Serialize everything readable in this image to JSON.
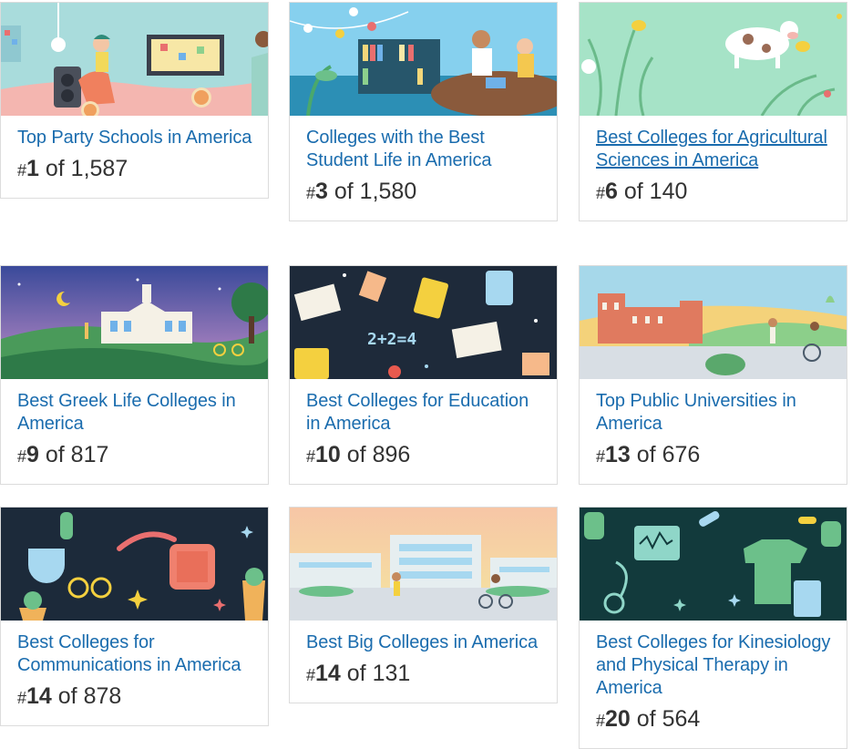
{
  "rankings": [
    {
      "title": "Top Party Schools in America",
      "hash": "#",
      "rank": "1",
      "of_text": "of 1,587",
      "scene": "party-scene"
    },
    {
      "title": "Colleges with the Best Student Life in America",
      "hash": "#",
      "rank": "3",
      "of_text": "of 1,580",
      "scene": "student-life-scene"
    },
    {
      "title": "Best Colleges for Agricultural Sciences in America",
      "hash": "#",
      "rank": "6",
      "of_text": "of 140",
      "scene": "agriculture-scene"
    },
    {
      "title": "Best Greek Life Colleges in America",
      "hash": "#",
      "rank": "9",
      "of_text": "of 817",
      "scene": "greek-life-scene"
    },
    {
      "title": "Best Colleges for Education in America",
      "hash": "#",
      "rank": "10",
      "of_text": "of 896",
      "scene": "education-scene"
    },
    {
      "title": "Top Public Universities in America",
      "hash": "#",
      "rank": "13",
      "of_text": "of 676",
      "scene": "public-university-scene"
    },
    {
      "title": "Best Colleges for Communications in America",
      "hash": "#",
      "rank": "14",
      "of_text": "of 878",
      "scene": "communications-scene"
    },
    {
      "title": "Best Big Colleges in America",
      "hash": "#",
      "rank": "14",
      "of_text": "of 131",
      "scene": "big-college-scene"
    },
    {
      "title": "Best Colleges for Kinesiology and Physical Therapy in America",
      "hash": "#",
      "rank": "20",
      "of_text": "of 564",
      "scene": "kinesiology-scene"
    }
  ],
  "colors": {
    "link": "#1a6cae",
    "text": "#333333",
    "border": "#dcdcdc"
  }
}
